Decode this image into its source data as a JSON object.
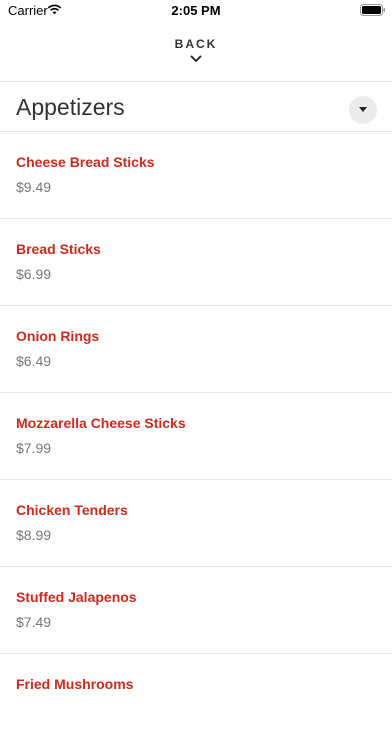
{
  "status_bar": {
    "carrier": "Carrier",
    "time": "2:05 PM",
    "wifi_icon": "wifi-icon",
    "battery_icon": "battery-icon"
  },
  "nav": {
    "back_label": "BACK",
    "chevron_icon": "chevron-down-icon"
  },
  "section": {
    "title": "Appetizers",
    "dropdown_icon": "caret-down-icon"
  },
  "colors": {
    "item_name": "#d12a1c",
    "price": "#777777",
    "divider": "#e6e6e6"
  },
  "menu_items": [
    {
      "name": "Cheese Bread Sticks",
      "price": "$9.49"
    },
    {
      "name": "Bread Sticks",
      "price": "$6.99"
    },
    {
      "name": "Onion Rings",
      "price": "$6.49"
    },
    {
      "name": "Mozzarella Cheese Sticks",
      "price": "$7.99"
    },
    {
      "name": "Chicken Tenders",
      "price": "$8.99"
    },
    {
      "name": "Stuffed Jalapenos",
      "price": "$7.49"
    },
    {
      "name": "Fried Mushrooms",
      "price": ""
    }
  ]
}
